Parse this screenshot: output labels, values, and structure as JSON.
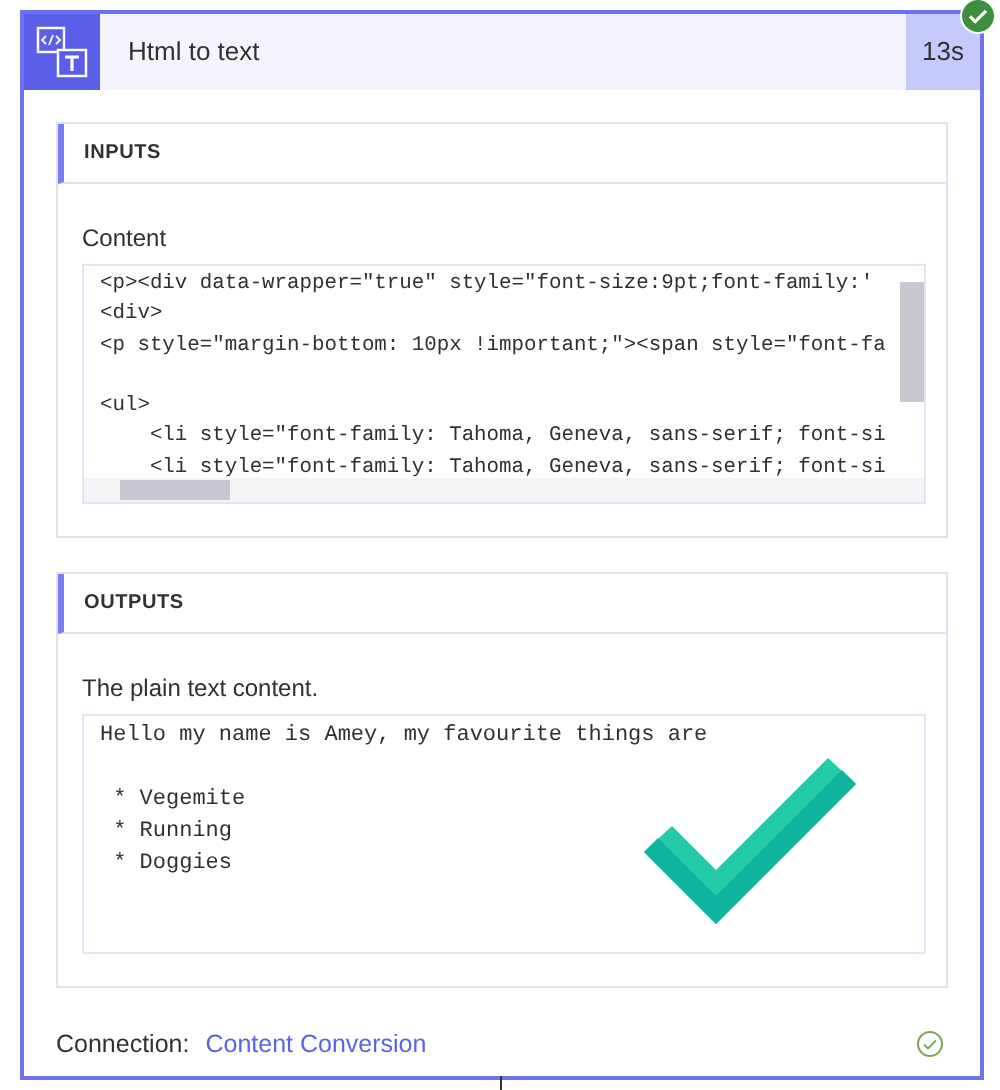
{
  "action": {
    "title": "Html to text",
    "duration": "13s",
    "succeeded": true
  },
  "inputs": {
    "header": "INPUTS",
    "label": "Content",
    "code_lines": [
      {
        "kind": "text",
        "text": "<p><div data-wrapper=\"true\" style=\"font-size:9pt;font-family:'"
      },
      {
        "kind": "text",
        "text": "<div>"
      },
      {
        "kind": "text",
        "text": "<p style=\"margin-bottom: 10px !important;\"><span style=\"font-fa"
      },
      {
        "kind": "blank"
      },
      {
        "kind": "text",
        "text": "<ul>"
      },
      {
        "kind": "text",
        "text": "    <li style=\"font-family: Tahoma, Geneva, sans-serif; font-si"
      },
      {
        "kind": "text",
        "text": "    <li style=\"font-family: Tahoma, Geneva, sans-serif; font-si"
      }
    ]
  },
  "outputs": {
    "header": "OUTPUTS",
    "label": "The plain text content.",
    "text_lines": [
      {
        "kind": "text",
        "text": "Hello my name is Amey, my favourite things are"
      },
      {
        "kind": "blank"
      },
      {
        "kind": "text",
        "text": " * Vegemite"
      },
      {
        "kind": "text",
        "text": " * Running"
      },
      {
        "kind": "text",
        "text": " * Doggies"
      }
    ]
  },
  "connection": {
    "label": "Connection:",
    "name": "Content Conversion"
  }
}
